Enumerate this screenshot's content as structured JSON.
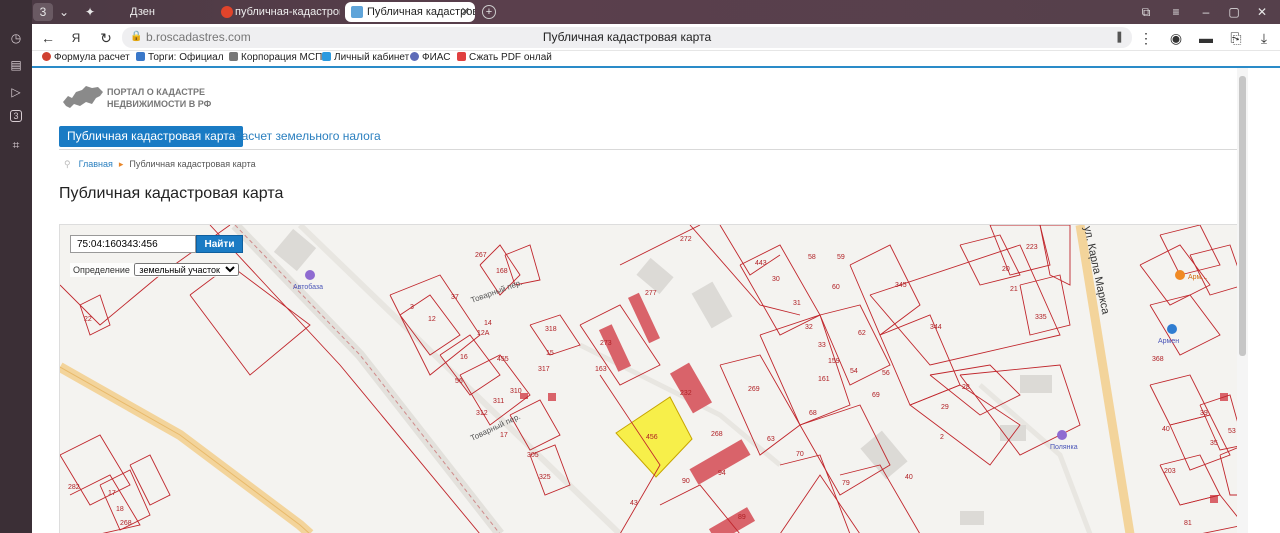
{
  "browser": {
    "tabs": [
      {
        "label": "Дзен"
      },
      {
        "label": "публичная-кадастровая"
      },
      {
        "label": "Публичная кадастровая"
      }
    ],
    "tab_counter": "3",
    "url": "b.roscadastres.com",
    "page_title": "Публичная кадастровая карта",
    "bookmarks": [
      "Формула расчет",
      "Торги: Официал",
      "Корпорация МСП",
      "Личный кабинет",
      "ФИАС",
      "Сжать PDF онлай"
    ]
  },
  "site": {
    "logo_line1": "ПОРТАЛ О КАДАСТРЕ",
    "logo_line2": "НЕДВИЖИМОСТИ В РФ",
    "nav_active": "Публичная кадастровая карта",
    "nav_link": "Расчет земельного налога",
    "breadcrumb_home": "Главная",
    "breadcrumb_current": "Публичная кадастровая карта",
    "heading": "Публичная кадастровая карта"
  },
  "map": {
    "search_value": "75:04:160343:456",
    "search_button": "Найти",
    "definition_label": "Определение",
    "definition_option": "земельный участок",
    "selected_parcel": "456",
    "streets": [
      "Товарный пер.",
      "ул. Карла Маркса"
    ],
    "pois": [
      "Автобаза",
      "Полянка",
      "Армен",
      "Арм..."
    ],
    "parcel_labels": [
      "272",
      "277",
      "345",
      "344",
      "163",
      "267",
      "168",
      "12",
      "14",
      "455",
      "318",
      "317",
      "16",
      "17",
      "56",
      "312",
      "311",
      "310",
      "305",
      "325",
      "232",
      "273",
      "269",
      "268",
      "68",
      "63",
      "70",
      "79",
      "40",
      "62",
      "54",
      "69",
      "29",
      "28",
      "2",
      "43",
      "89",
      "90",
      "94",
      "22",
      "282",
      "17",
      "18",
      "268",
      "20",
      "223",
      "21",
      "335",
      "368",
      "40",
      "39",
      "35",
      "53",
      "203",
      "81",
      "60",
      "59",
      "58",
      "56",
      "30",
      "31",
      "32",
      "33",
      "159",
      "161",
      "37",
      "12А",
      "15",
      "3",
      "443",
      "345",
      "336",
      "184",
      "162",
      "147",
      "134",
      "93",
      "29",
      "28",
      "27",
      "26"
    ]
  }
}
